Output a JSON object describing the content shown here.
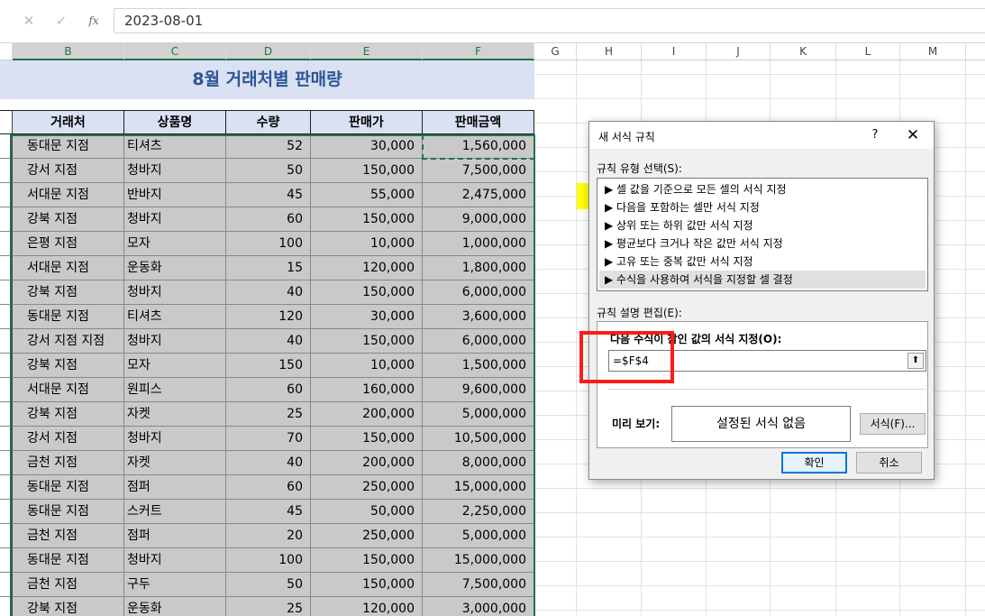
{
  "formula_bar": {
    "cancel_icon": "✕",
    "enter_icon": "✓",
    "fx_label": "fx",
    "value": "2023-08-01"
  },
  "columns": [
    "B",
    "C",
    "D",
    "E",
    "F",
    "G",
    "H",
    "I",
    "J",
    "K",
    "L",
    "M"
  ],
  "sheet": {
    "title": "8월 거래처별 판매량",
    "headers": [
      "거래처",
      "상품명",
      "수량",
      "판매가",
      "판매금액"
    ],
    "rows": [
      [
        "동대문 지점",
        "티셔츠",
        "52",
        "30,000",
        "1,560,000"
      ],
      [
        "강서 지점",
        "청바지",
        "50",
        "150,000",
        "7,500,000"
      ],
      [
        "서대문 지점",
        "반바지",
        "45",
        "55,000",
        "2,475,000"
      ],
      [
        "강북 지점",
        "청바지",
        "60",
        "150,000",
        "9,000,000"
      ],
      [
        "은평 지점",
        "모자",
        "100",
        "10,000",
        "1,000,000"
      ],
      [
        "서대문 지점",
        "운동화",
        "15",
        "120,000",
        "1,800,000"
      ],
      [
        "강북 지점",
        "청바지",
        "40",
        "150,000",
        "6,000,000"
      ],
      [
        "동대문 지점",
        "티셔츠",
        "120",
        "30,000",
        "3,600,000"
      ],
      [
        "강서 지점 지점",
        "청바지",
        "40",
        "150,000",
        "6,000,000"
      ],
      [
        "강북 지점",
        "모자",
        "150",
        "10,000",
        "1,500,000"
      ],
      [
        "서대문 지점",
        "원피스",
        "60",
        "160,000",
        "9,600,000"
      ],
      [
        "강북 지점",
        "자켓",
        "25",
        "200,000",
        "5,000,000"
      ],
      [
        "강서 지점",
        "청바지",
        "70",
        "150,000",
        "10,500,000"
      ],
      [
        "금천 지점",
        "자켓",
        "40",
        "200,000",
        "8,000,000"
      ],
      [
        "동대문 지점",
        "점퍼",
        "60",
        "250,000",
        "15,000,000"
      ],
      [
        "동대문 지점",
        "스커트",
        "45",
        "50,000",
        "2,250,000"
      ],
      [
        "금천 지점",
        "점퍼",
        "20",
        "250,000",
        "5,000,000"
      ],
      [
        "동대문 지점",
        "청바지",
        "100",
        "150,000",
        "15,000,000"
      ],
      [
        "금천 지점",
        "구두",
        "50",
        "150,000",
        "7,500,000"
      ],
      [
        "강북 지점",
        "운동화",
        "25",
        "120,000",
        "3,000,000"
      ]
    ]
  },
  "dialog": {
    "title": "새 서식 규칙",
    "help": "?",
    "close": "✕",
    "rule_type_label": "규칙 유형 선택(S):",
    "rule_types": [
      "▶ 셀 값을 기준으로 모든 셀의 서식 지정",
      "▶ 다음을 포함하는 셀만 서식 지정",
      "▶ 상위 또는 하위 값만 서식 지정",
      "▶ 평균보다 크거나 작은 값만 서식 지정",
      "▶ 고유 또는 중복 값만 서식 지정",
      "▶ 수식을 사용하여 서식을 지정할 셀 결정"
    ],
    "edit_label": "규칙 설명 편집(E):",
    "formula_label": "다음 수식이 참인 값의 서식 지정(O):",
    "formula_value": "=$F$4",
    "collapse_icon": "⬆",
    "preview_label": "미리 보기:",
    "preview_text": "설정된 서식 없음",
    "format_button": "서식(F)...",
    "ok_button": "확인",
    "cancel_button": "취소"
  },
  "colors": {
    "excel_green": "#217346",
    "title_band": "#d9e1f2",
    "title_text": "#2f5597",
    "data_fill": "#c9c9c9",
    "highlight_red": "#ff1a1a",
    "yellow": "#ffff00"
  }
}
